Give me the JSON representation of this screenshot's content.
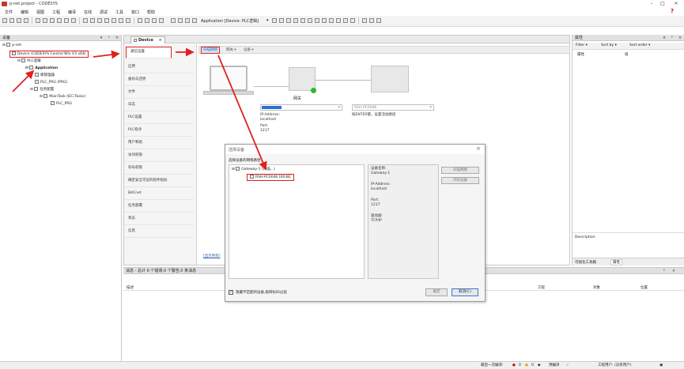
{
  "window": {
    "title": "p-net.project - CODESYS",
    "help_badge": "?"
  },
  "menu": [
    "文件",
    "编辑",
    "视图",
    "工程",
    "编译",
    "在线",
    "调试",
    "工具",
    "窗口",
    "帮助"
  ],
  "toolbar": {
    "application_combo": "Application [Device: PLC逻辑]"
  },
  "devices_pane": {
    "title": "设备",
    "tree": [
      {
        "label": "p-net",
        "level": 0
      },
      {
        "label": "Device (CODESYS Control Win V3 x64)",
        "level": 1,
        "highlighted": true
      },
      {
        "label": "PLC逻辑",
        "level": 2
      },
      {
        "label": "Application",
        "level": 3
      },
      {
        "label": "库管理器",
        "level": 4
      },
      {
        "label": "PLC_PRG (PRG)",
        "level": 4
      },
      {
        "label": "任务配置",
        "level": 4
      },
      {
        "label": "MainTask (IEC-Tasks)",
        "level": 5
      },
      {
        "label": "PLC_PRG",
        "level": 6
      }
    ]
  },
  "editor": {
    "tab_label": "Device",
    "nav": [
      "通信设置",
      "应用",
      "备份与还原",
      "文件",
      "日志",
      "PLC设置",
      "PLC指令",
      "用户和组",
      "访问权限",
      "符号权限",
      "确定安全可证的软件指标",
      "BACnet",
      "任务部署",
      "状态",
      "信息"
    ],
    "subtoolbar": {
      "scan": "扫描网络",
      "gateway": "网关 ▾",
      "device": "设备 ▾"
    },
    "gateway_label": "网关",
    "gateway_info": {
      "ip_label": "IP-Address:",
      "ip": "localhost",
      "port_label": "Port:",
      "port": "1217"
    },
    "device_combo": "RSH-PC0046",
    "device_hint": "按ENTER键，设置活动路径",
    "bottom_link": "[显示所有]"
  },
  "dialog": {
    "title": "选择设备",
    "tree_caption": "选择设备的网络路径：",
    "gateway_node": "Gateway-1 (扫描...)",
    "device_node": "RSH-PC0046 [0038]",
    "props": [
      {
        "label": "设备名称:",
        "value": "Gateway-1"
      },
      {
        "label": "IP-Address:",
        "value": "localhost"
      },
      {
        "label": "Port:",
        "value": "1217"
      },
      {
        "label": "驱动器:",
        "value": "TCP/IP"
      }
    ],
    "btn_scan": "扫描网络",
    "btn_wink": "闪烁设备",
    "filter_label": "隐藏不匹配的设备,按目标ID过滤",
    "btn_ok": "确定",
    "btn_cancel": "取消(C)"
  },
  "properties_pane": {
    "title": "属性",
    "filter_btn": "Filter ▾",
    "sortby_btn": "Sort by ▾",
    "sortorder_btn": "Sort order ▾",
    "col_property": "属性",
    "col_value": "值",
    "description": "Description",
    "tab_toolbox": "可视化工具箱",
    "tab_properties": "属性"
  },
  "messages_pane": {
    "title": "消息 - 总计 0 个错误,0 个警告,0 条消息",
    "col_desc": "描述",
    "col_project": "工程",
    "col_object": "对象",
    "col_position": "位置"
  },
  "status": {
    "last_build": "最后一次编译:",
    "errors": "0",
    "warnings": "0",
    "precompile": "预编译",
    "project_user": "工程用户: (没有用户)"
  },
  "colors": {
    "accent_red": "#e02020",
    "progress_blue": "#2f6fd0",
    "online_green": "#2eb82e"
  }
}
